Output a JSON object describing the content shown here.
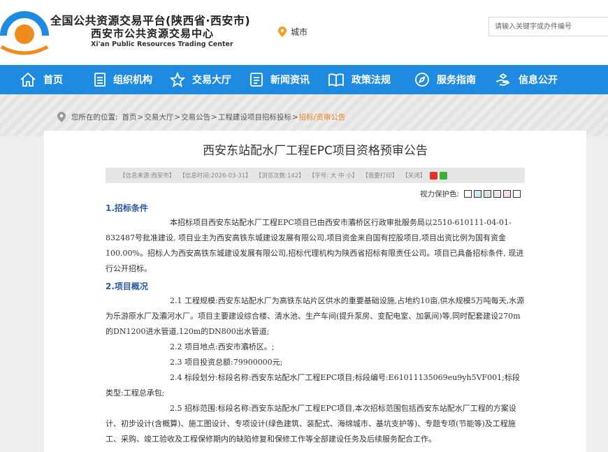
{
  "header": {
    "title": "全国公共资源交易平台(陕西省·西安市)",
    "subtitle": "西安市公共资源交易中心",
    "english": "Xi'an Public Resources Trading Center",
    "city_label": "城市",
    "search_placeholder": "请输入关键字或办件编号",
    "logo_colors": {
      "arc": "#1e8ae0",
      "dot": "#f08c1e"
    }
  },
  "nav": {
    "items": [
      {
        "label": "首页",
        "icon": "home-icon"
      },
      {
        "label": "组织机构",
        "icon": "document-icon"
      },
      {
        "label": "交易大厅",
        "icon": "star-icon"
      },
      {
        "label": "新闻资讯",
        "icon": "list-icon"
      },
      {
        "label": "政策法规",
        "icon": "book-icon"
      },
      {
        "label": "服务指南",
        "icon": "compass-icon"
      },
      {
        "label": "信息公开",
        "icon": "hand-icon"
      }
    ],
    "bg_color": "#1e8ae0"
  },
  "breadcrumb": {
    "prefix": "您所在的位置:",
    "items": [
      "首页",
      "交易大厅",
      "交易公告",
      "工程建设项目招标投标"
    ],
    "current": "招标/资审公告",
    "separator": ">"
  },
  "article": {
    "title": "西安东站配水厂工程EPC项目资格预审公告",
    "info": {
      "source": "【信息来源:西安市】",
      "time": "【信息时间:2026-03-31】",
      "views": "【浏览次数:142】",
      "font_size": "【字号: 大 中 小】",
      "print": "【我要打印】",
      "close": "【关闭】"
    },
    "eye_protect_label": "视力保护色:",
    "eye_colors": [
      "#ffffff",
      "#cde8f6",
      "#d9e6d9",
      "#e8e8e8",
      "#f5dcec",
      "#ffffff"
    ],
    "sections": [
      {
        "heading": "1.招标条件",
        "paragraphs": [
          "本招标项目西安东站配水厂工程EPC项目已由西安市灞桥区行政审批服务局以2510-610111-04-01-832487号批准建设, 项目业主为西安高铁东城建设发展有限公司,项目资金来自国有控股项目,项目出资比例为国有资金100.00%。招标人为西安高铁东城建设发展有限公司,招标代理机构为陕西省招标有限责任公司。项目已具备招标条件, 现进行公开招标。"
        ]
      },
      {
        "heading": "2.项目概况",
        "paragraphs": [
          "2.1 工程规模:西安东站配水厂为高铁东站片区供水的重要基础设施,占地约10亩,供水规模5万吨每天,水源为乐游原水厂及灞河水厂。项目主要建设综合楼、清水池、生产车间(提升泵房、变配电室、加氯间)等,同时配套建设270m的DN1200进水管道,120m的DN800出水管道;",
          "2.2 项目地点:西安市灞桥区。;",
          "2.3 项目投资总额:79900000元;",
          "2.4 标段划分:标段名称:西安东站配水厂工程EPC项目;标段编号:E61011135069eu9yh5VF001;标段类型:工程总承包;",
          "2.5 招标范围:标段名称:西安东站配水厂工程EPC项目,本次招标范围包括西安东站配水厂工程的方案设计、初步设计(含概算)、施工图设计、专项设计(绿色建筑、装配式、海绵城市、基坑支护等)、专题专项(节能等)及工程施工、采购、竣工验收及工程保修期内的缺陷修复和保修工作等全部建设任务及后续服务配合工作。"
        ]
      }
    ]
  }
}
